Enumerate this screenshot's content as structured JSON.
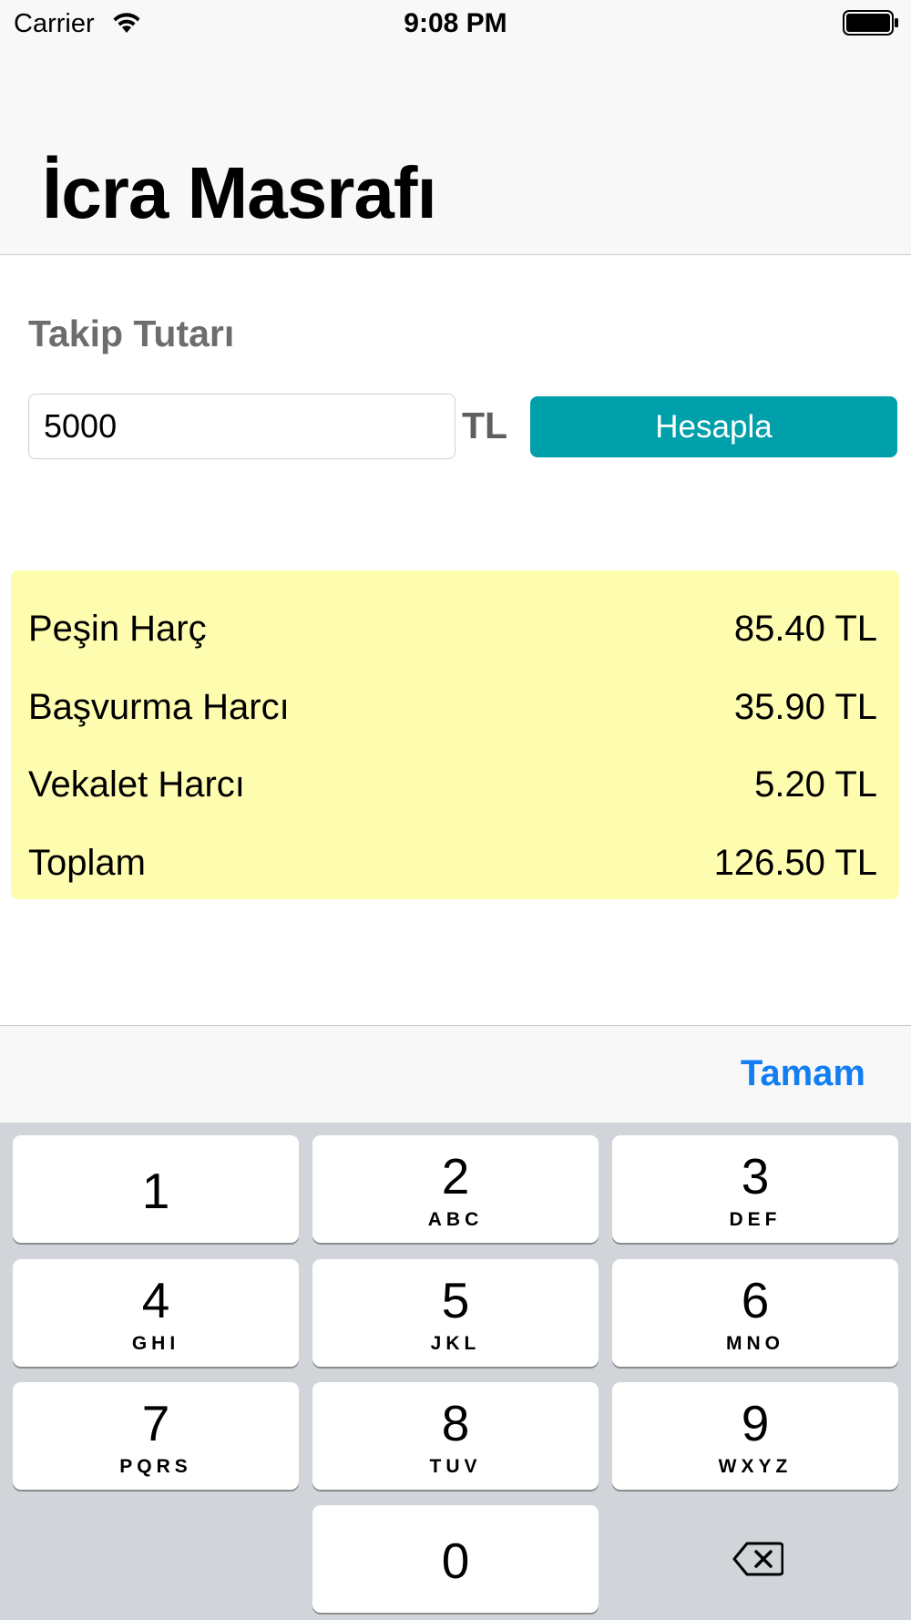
{
  "status_bar": {
    "carrier": "Carrier",
    "time": "9:08 PM"
  },
  "nav": {
    "title": "İcra Masrafı"
  },
  "form": {
    "label": "Takip Tutarı",
    "amount_value": "5000",
    "currency": "TL",
    "calculate_label": "Hesapla"
  },
  "results": {
    "rows": [
      {
        "label": "Peşin Harç",
        "value": "85.40 TL"
      },
      {
        "label": "Başvurma Harcı",
        "value": "35.90 TL"
      },
      {
        "label": "Vekalet Harcı",
        "value": "5.20 TL"
      },
      {
        "label": "Toplam",
        "value": "126.50 TL"
      }
    ],
    "background_color": "#fefcaf"
  },
  "keyboard": {
    "done_label": "Tamam",
    "keys": [
      {
        "digit": "1",
        "letters": ""
      },
      {
        "digit": "2",
        "letters": "ABC"
      },
      {
        "digit": "3",
        "letters": "DEF"
      },
      {
        "digit": "4",
        "letters": "GHI"
      },
      {
        "digit": "5",
        "letters": "JKL"
      },
      {
        "digit": "6",
        "letters": "MNO"
      },
      {
        "digit": "7",
        "letters": "PQRS"
      },
      {
        "digit": "8",
        "letters": "TUV"
      },
      {
        "digit": "9",
        "letters": "WXYZ"
      },
      {
        "digit": "0",
        "letters": ""
      }
    ],
    "delete_icon": "backspace-icon"
  },
  "colors": {
    "accent": "#00a0ab",
    "done": "#137ef2"
  }
}
